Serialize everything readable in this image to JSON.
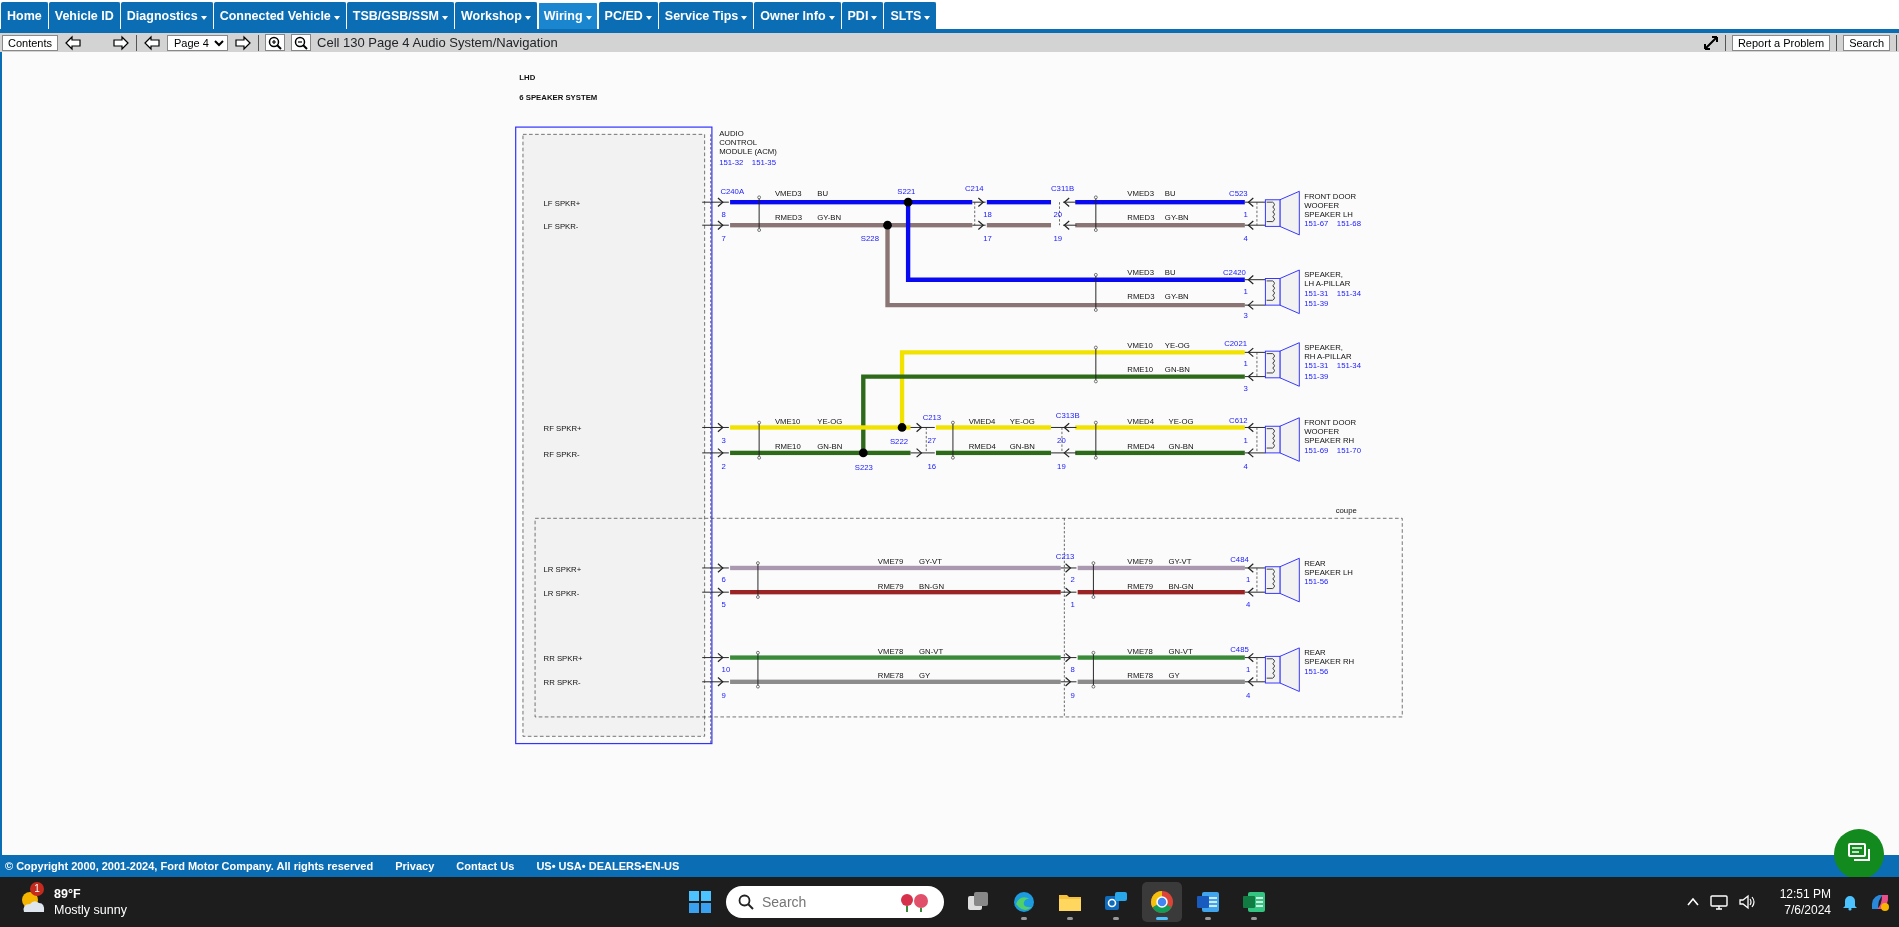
{
  "nav": {
    "tabs": [
      {
        "label": "Home",
        "dropdown": false,
        "selected": false
      },
      {
        "label": "Vehicle ID",
        "dropdown": false,
        "selected": false
      },
      {
        "label": "Diagnostics",
        "dropdown": true,
        "selected": false
      },
      {
        "label": "Connected Vehicle",
        "dropdown": true,
        "selected": false
      },
      {
        "label": "TSB/GSB/SSM",
        "dropdown": true,
        "selected": false
      },
      {
        "label": "Workshop",
        "dropdown": true,
        "selected": false
      },
      {
        "label": "Wiring",
        "dropdown": true,
        "selected": true
      },
      {
        "label": "PC/ED",
        "dropdown": true,
        "selected": false
      },
      {
        "label": "Service Tips",
        "dropdown": true,
        "selected": false
      },
      {
        "label": "Owner Info",
        "dropdown": true,
        "selected": false
      },
      {
        "label": "PDI",
        "dropdown": true,
        "selected": false
      },
      {
        "label": "SLTS",
        "dropdown": true,
        "selected": false
      }
    ]
  },
  "toolbar": {
    "contents_button": "Contents",
    "page_select": "Page 4",
    "title": "Cell 130 Page 4 Audio System/Navigation",
    "report_button": "Report a Problem",
    "search_button": "Search"
  },
  "diagram": {
    "heading": [
      "LHD",
      "6 SPEAKER SYSTEM"
    ],
    "module": {
      "name_lines": [
        "AUDIO",
        "CONTROL",
        "MODULE (ACM)"
      ],
      "refs": [
        "151-32",
        "151-35"
      ],
      "pins": [
        "LF SPKR+",
        "LF SPKR-",
        "RF SPKR+",
        "RF SPKR-",
        "LR SPKR+",
        "LR SPKR-",
        "RR SPKR+",
        "RR SPKR-"
      ]
    },
    "zone": "coupe",
    "connectors": [
      {
        "name": "C240A",
        "pins": [
          "8",
          "7",
          "3",
          "2",
          "6",
          "5",
          "10",
          "9"
        ]
      },
      {
        "name": "C214",
        "pins": [
          "18",
          "17"
        ]
      },
      {
        "name": "C311B",
        "pins": [
          "20",
          "19"
        ]
      },
      {
        "name": "C523",
        "pins": [
          "1",
          "4"
        ]
      },
      {
        "name": "C2420",
        "pins": [
          "1",
          "3"
        ]
      },
      {
        "name": "C2021",
        "pins": [
          "1",
          "3"
        ]
      },
      {
        "name": "C213",
        "pins": [
          "27",
          "16"
        ]
      },
      {
        "name": "C313B",
        "pins": [
          "20",
          "19"
        ]
      },
      {
        "name": "C612",
        "pins": [
          "1",
          "4"
        ]
      },
      {
        "name": "C213",
        "pins": [
          "2",
          "1",
          "8",
          "9"
        ]
      },
      {
        "name": "C484",
        "pins": [
          "1",
          "4"
        ]
      },
      {
        "name": "C485",
        "pins": [
          "1",
          "4"
        ]
      }
    ],
    "splices": [
      "S221",
      "S228",
      "S222",
      "S223"
    ],
    "wires": [
      {
        "circuit": "VMED3",
        "code": "BU",
        "color": "#0a0af0"
      },
      {
        "circuit": "RMED3",
        "code": "GY-BN",
        "color": "#8a7474"
      },
      {
        "circuit": "VMED3",
        "code": "BU",
        "color": "#0a0af0"
      },
      {
        "circuit": "RMED3",
        "code": "GY-BN",
        "color": "#8a7474"
      },
      {
        "circuit": "VMED3",
        "code": "BU",
        "color": "#0a0af0"
      },
      {
        "circuit": "RMED3",
        "code": "GY-BN",
        "color": "#8a7474"
      },
      {
        "circuit": "VME10",
        "code": "YE-OG",
        "color": "#f2e200"
      },
      {
        "circuit": "RME10",
        "code": "GN-BN",
        "color": "#2d6a1a"
      },
      {
        "circuit": "VME10",
        "code": "YE-OG",
        "color": "#f2e200"
      },
      {
        "circuit": "RME10",
        "code": "GN-BN",
        "color": "#2d6a1a"
      },
      {
        "circuit": "VMED4",
        "code": "YE-OG",
        "color": "#f2e200"
      },
      {
        "circuit": "RMED4",
        "code": "GN-BN",
        "color": "#2d6a1a"
      },
      {
        "circuit": "VMED4",
        "code": "YE-OG",
        "color": "#f2e200"
      },
      {
        "circuit": "RMED4",
        "code": "GN-BN",
        "color": "#2d6a1a"
      },
      {
        "circuit": "VME79",
        "code": "GY-VT",
        "color": "#aa98b0"
      },
      {
        "circuit": "RME79",
        "code": "BN-GN",
        "color": "#9a2424"
      },
      {
        "circuit": "VME79",
        "code": "GY-VT",
        "color": "#aa98b0"
      },
      {
        "circuit": "RME79",
        "code": "BN-GN",
        "color": "#9a2424"
      },
      {
        "circuit": "VME78",
        "code": "GN-VT",
        "color": "#3a8a3a"
      },
      {
        "circuit": "RME78",
        "code": "GY",
        "color": "#8c8c8c"
      },
      {
        "circuit": "VME78",
        "code": "GN-VT",
        "color": "#3a8a3a"
      },
      {
        "circuit": "RME78",
        "code": "GY",
        "color": "#8c8c8c"
      }
    ],
    "speakers": [
      {
        "lines": [
          "FRONT DOOR",
          "WOOFER",
          "SPEAKER LH"
        ],
        "refs": [
          "151-67",
          "151-68"
        ]
      },
      {
        "lines": [
          "SPEAKER,",
          "LH A-PILLAR"
        ],
        "refs": [
          "151-31",
          "151-34",
          "151-39"
        ]
      },
      {
        "lines": [
          "SPEAKER,",
          "RH A-PILLAR"
        ],
        "refs": [
          "151-31",
          "151-34",
          "151-39"
        ]
      },
      {
        "lines": [
          "FRONT DOOR",
          "WOOFER",
          "SPEAKER RH"
        ],
        "refs": [
          "151-69",
          "151-70"
        ]
      },
      {
        "lines": [
          "REAR",
          "SPEAKER LH"
        ],
        "refs": [
          "151-56"
        ]
      },
      {
        "lines": [
          "REAR",
          "SPEAKER RH"
        ],
        "refs": [
          "151-56"
        ]
      }
    ]
  },
  "footer": {
    "copyright": "© Copyright 2000, 2001-2024, Ford Motor Company. All rights reserved",
    "links": [
      "Privacy",
      "Contact Us"
    ],
    "locale": "US• USA• DEALERS•EN-US"
  },
  "taskbar": {
    "weather": {
      "badge": "1",
      "temperature": "89°F",
      "condition": "Mostly sunny"
    },
    "search": {
      "placeholder": "Search"
    },
    "apps": [
      {
        "kind": "taskview",
        "running": false,
        "selected": false
      },
      {
        "kind": "swirl",
        "running": true,
        "selected": false
      },
      {
        "kind": "folder",
        "running": true,
        "selected": false
      },
      {
        "kind": "mail",
        "running": true,
        "selected": false
      },
      {
        "kind": "wheel",
        "running": true,
        "selected": true
      },
      {
        "kind": "doc",
        "running": true,
        "selected": false
      },
      {
        "kind": "sheet",
        "running": true,
        "selected": false
      }
    ],
    "time": "12:51 PM",
    "date": "7/6/2024"
  }
}
